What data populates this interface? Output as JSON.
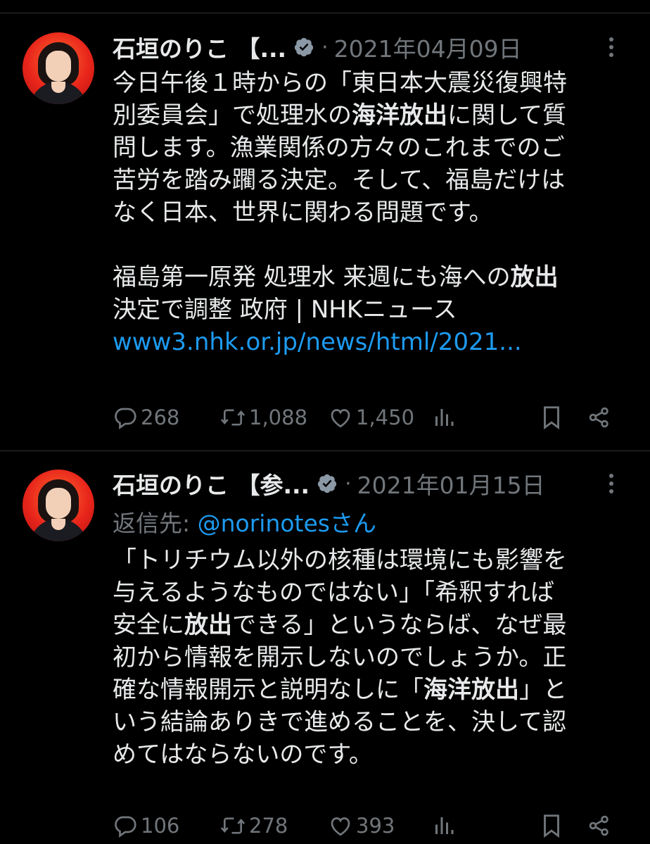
{
  "tweets": [
    {
      "author_name": "石垣のりこ 【...",
      "separator": "·",
      "date": "2021年04月09日",
      "body_lines": [
        [
          {
            "t": "今日午後１時からの「東日本大震災復興特"
          }
        ],
        [
          {
            "t": "別委員会」で処理水の"
          },
          {
            "t": "海洋放出",
            "b": true
          },
          {
            "t": "に関して質"
          }
        ],
        [
          {
            "t": "問します。漁業関係の方々のこれまでのご"
          }
        ],
        [
          {
            "t": "苦労を踏み躙る決定。そして、福島だけは"
          }
        ],
        [
          {
            "t": "なく日本、世界に関わる問題です。"
          }
        ],
        [
          {
            "t": ""
          }
        ],
        [
          {
            "t": "福島第一原発 処理水 来週にも海への"
          },
          {
            "t": "放出",
            "b": true
          }
        ],
        [
          {
            "t": "決定で調整 政府 | NHKニュース"
          }
        ],
        [
          {
            "t": "www3.nhk.or.jp/news/html/2021...",
            "link": true
          }
        ]
      ],
      "replies": "268",
      "retweets": "1,088",
      "likes": "1,450"
    },
    {
      "author_name": "石垣のりこ 【参...",
      "separator": "·",
      "date": "2021年01月15日",
      "reply_to_prefix": "返信先: ",
      "reply_to_handle": "@norinotesさん",
      "body_lines": [
        [
          {
            "t": "「トリチウム以外の核種は環境にも影響を"
          }
        ],
        [
          {
            "t": "与えるようなものではない」「希釈すれば"
          }
        ],
        [
          {
            "t": "安全に"
          },
          {
            "t": "放出",
            "b": true
          },
          {
            "t": "できる」というならば、なぜ最"
          }
        ],
        [
          {
            "t": "初から情報を開示しないのでしょうか。正"
          }
        ],
        [
          {
            "t": "確な情報開示と説明なしに「"
          },
          {
            "t": "海洋放出",
            "b": true
          },
          {
            "t": "」と"
          }
        ],
        [
          {
            "t": "いう結論ありきで進めることを、決して認"
          }
        ],
        [
          {
            "t": "めてはならないのです。"
          }
        ]
      ],
      "replies": "106",
      "retweets": "278",
      "likes": "393"
    }
  ],
  "colors": {
    "background": "#000000",
    "text": "#e7e9ea",
    "muted": "#71767b",
    "link": "#1d9bf0",
    "divider": "#2f3336"
  },
  "icons": [
    "verified-badge-icon",
    "more-icon",
    "reply-icon",
    "retweet-icon",
    "like-icon",
    "views-icon",
    "bookmark-icon",
    "share-icon"
  ]
}
